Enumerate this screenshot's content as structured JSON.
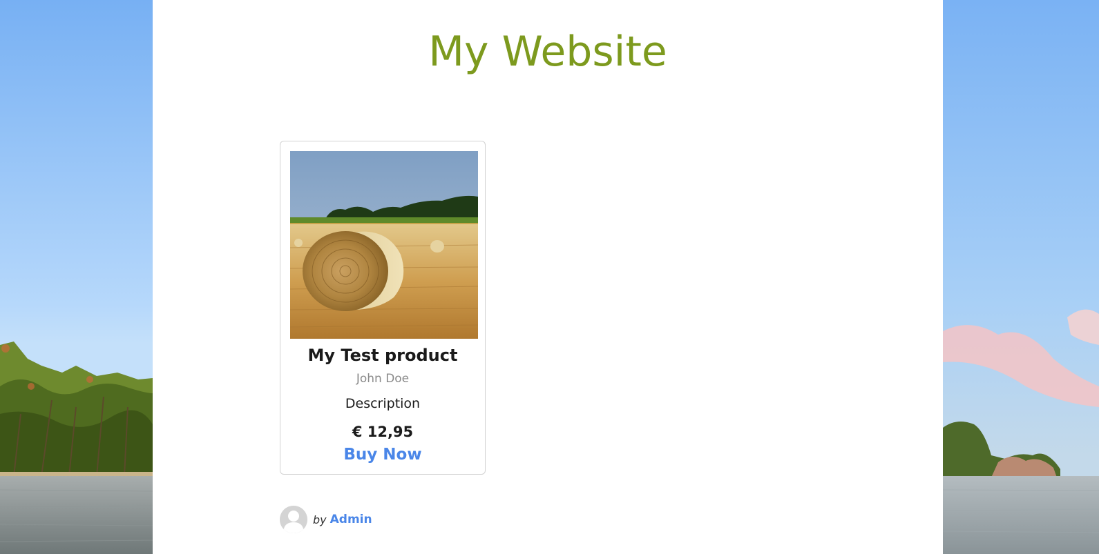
{
  "site": {
    "title": "My Website"
  },
  "product": {
    "title": "My Test product",
    "author": "John Doe",
    "description": "Description",
    "price": "€ 12,95",
    "buy_label": "Buy Now",
    "image_icon": "hay-bale-field-image"
  },
  "byline": {
    "by_text": "by",
    "author": "Admin",
    "avatar_icon": "default-avatar-icon"
  },
  "colors": {
    "title": "#7d9a1e",
    "link": "#4a86e8",
    "text": "#1a1a1a",
    "muted": "#8a8a8a"
  }
}
